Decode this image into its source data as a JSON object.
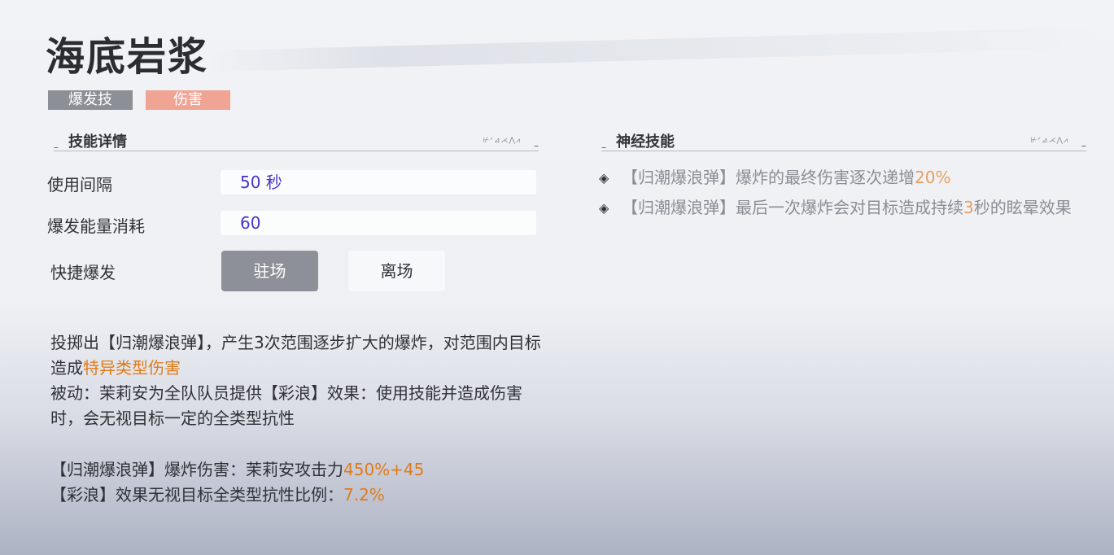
{
  "skill": {
    "name": "海底岩浆",
    "tags": [
      "爆发技",
      "伤害"
    ]
  },
  "details_section": {
    "title": "技能详情",
    "ornament": "⊬ᐟ⊿⋌⋀⩘",
    "rows": [
      {
        "label": "使用间隔",
        "value": "50 秒"
      },
      {
        "label": "爆发能量消耗",
        "value": "60"
      }
    ],
    "quick_burst": {
      "label": "快捷爆发",
      "options": [
        "驻场",
        "离场"
      ],
      "selected": "驻场"
    }
  },
  "description": {
    "line1_prefix": "投掷出【归潮爆浪弹】，产生3次范围逐步扩大的爆炸，对范围内目标造成",
    "line1_highlight": "特异类型伤害",
    "passive": "被动：茉莉安为全队队员提供【彩浪】效果：使用技能并造成伤害时，会无视目标一定的全类型抗性",
    "stat1_label": "【归潮爆浪弹】爆炸伤害：茉莉安攻击力",
    "stat1_value": "450%+45",
    "stat2_label": "【彩浪】效果无视目标全类型抗性比例：",
    "stat2_value": "7.2%"
  },
  "neural_section": {
    "title": "神经技能",
    "ornament": "⊬ᐟ⊿⋌⋀⩘",
    "items": [
      {
        "prefix": "【归潮爆浪弹】爆炸的最终伤害逐次递增",
        "highlight": "20%",
        "suffix": ""
      },
      {
        "prefix": "【归潮爆浪弹】最后一次爆炸会对目标造成持续",
        "highlight": "3",
        "suffix": "秒的眩晕效果"
      }
    ]
  },
  "colors": {
    "burst_tag": "#8c8f96",
    "damage_tag": "#f0a494",
    "value_text": "#4a32c8",
    "highlight_orange": "#e07b1a",
    "active_toggle": "#8e9099"
  }
}
